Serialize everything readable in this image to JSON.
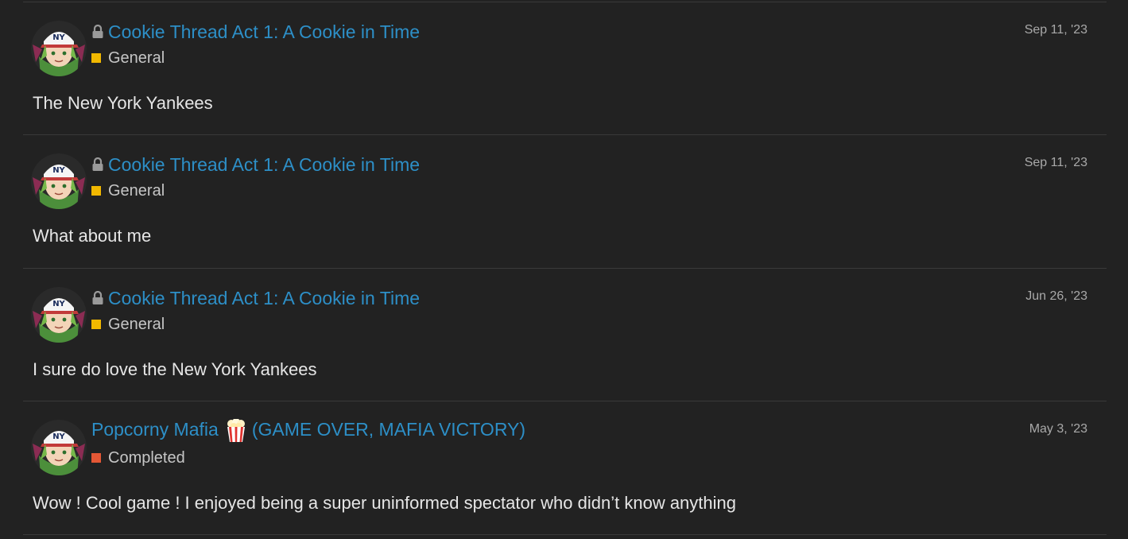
{
  "posts": [
    {
      "title": "Cookie Thread Act 1: A Cookie in Time",
      "locked": true,
      "category": "General",
      "category_color": "#f1b800",
      "date": "Sep 11, '23",
      "excerpt": "The New York Yankees"
    },
    {
      "title": "Cookie Thread Act 1: A Cookie in Time",
      "locked": true,
      "category": "General",
      "category_color": "#f1b800",
      "date": "Sep 11, '23",
      "excerpt": "What about me"
    },
    {
      "title": "Cookie Thread Act 1: A Cookie in Time",
      "locked": true,
      "category": "General",
      "category_color": "#f1b800",
      "date": "Jun 26, '23",
      "excerpt": "I sure do love the New York Yankees"
    },
    {
      "title": "Popcorny Mafia",
      "title_suffix": "(GAME OVER, MAFIA VICTORY)",
      "title_emoji": "popcorn-icon",
      "locked": false,
      "category": "Completed",
      "category_color": "#e45735",
      "date": "May 3, '23",
      "excerpt": "Wow ! Cool game ! I enjoyed being a super uninformed spectator who didn’t know anything"
    }
  ],
  "colors": {
    "background": "#222222",
    "link": "#2d8fc7",
    "divider": "#3a3a3a"
  },
  "avatar_icon": "user-avatar-yankees-cap"
}
